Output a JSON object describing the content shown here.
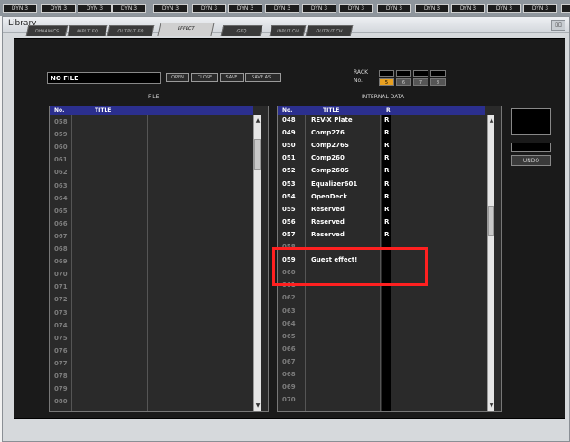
{
  "topstrip": {
    "tabs": [
      "DYN 3",
      "DYN 3",
      "DYN 3",
      "DYN 3",
      "DYN 3",
      "DYN 3",
      "DYN 3",
      "DYN 3",
      "DYN 3",
      "DYN 3",
      "DYN 3",
      "DYN 3",
      "DYN 3",
      "DYN 3",
      "DYN 3",
      "DYN 3",
      "DYN 3",
      "DYN 3",
      "D"
    ]
  },
  "window": {
    "title": "Library",
    "close_label": "▯▯"
  },
  "tabs": [
    "DYNAMICS",
    "INPUT EQ",
    "OUTPUT EQ",
    "EFFECT",
    "GEQ",
    "INPUT CH",
    "OUTPUT CH"
  ],
  "active_tab": "EFFECT",
  "file_bar": {
    "value": "NO FILE",
    "buttons": [
      "OPEN",
      "CLOSE",
      "SAVE",
      "SAVE AS..."
    ]
  },
  "rack": {
    "label": "RACK",
    "no_label": "No.",
    "numbers": [
      "5",
      "6",
      "7",
      "8"
    ],
    "selected": "5"
  },
  "sections": {
    "file": "FILE",
    "internal": "INTERNAL DATA"
  },
  "file_list": {
    "headers": {
      "no": "No.",
      "title": "TITLE"
    },
    "rows": [
      "058",
      "059",
      "060",
      "061",
      "062",
      "063",
      "064",
      "065",
      "066",
      "067",
      "068",
      "069",
      "070",
      "071",
      "072",
      "073",
      "074",
      "075",
      "076",
      "077",
      "078",
      "079",
      "080"
    ]
  },
  "internal_list": {
    "headers": {
      "no": "No.",
      "title": "TITLE",
      "r": "R"
    },
    "rows": [
      {
        "no": "048",
        "title": "REV-X Plate",
        "r": "R"
      },
      {
        "no": "049",
        "title": "Comp276",
        "r": "R"
      },
      {
        "no": "050",
        "title": "Comp276S",
        "r": "R"
      },
      {
        "no": "051",
        "title": "Comp260",
        "r": "R"
      },
      {
        "no": "052",
        "title": "Comp260S",
        "r": "R"
      },
      {
        "no": "053",
        "title": "Equalizer601",
        "r": "R"
      },
      {
        "no": "054",
        "title": "OpenDeck",
        "r": "R"
      },
      {
        "no": "055",
        "title": "Reserved",
        "r": "R"
      },
      {
        "no": "056",
        "title": "Reserved",
        "r": "R"
      },
      {
        "no": "057",
        "title": "Reserved",
        "r": "R"
      },
      {
        "no": "058",
        "title": "",
        "r": ""
      },
      {
        "no": "059",
        "title": "Guest effect!",
        "r": ""
      },
      {
        "no": "060",
        "title": "",
        "r": ""
      },
      {
        "no": "061",
        "title": "",
        "r": ""
      },
      {
        "no": "062",
        "title": "",
        "r": ""
      },
      {
        "no": "063",
        "title": "",
        "r": ""
      },
      {
        "no": "064",
        "title": "",
        "r": ""
      },
      {
        "no": "065",
        "title": "",
        "r": ""
      },
      {
        "no": "066",
        "title": "",
        "r": ""
      },
      {
        "no": "067",
        "title": "",
        "r": ""
      },
      {
        "no": "068",
        "title": "",
        "r": ""
      },
      {
        "no": "069",
        "title": "",
        "r": ""
      },
      {
        "no": "070",
        "title": "",
        "r": ""
      }
    ]
  },
  "undo_label": "UNDO",
  "colors": {
    "highlight": "#ff2020",
    "rack_selected": "#e8a020",
    "header": "#2b2f8e"
  }
}
